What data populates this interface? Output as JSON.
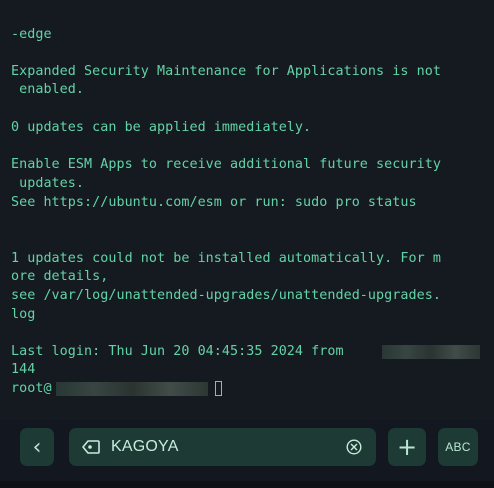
{
  "terminal": {
    "lines": [
      "-edge",
      "Expanded Security Maintenance for Applications is not",
      " enabled.",
      "0 updates can be applied immediately.",
      "Enable ESM Apps to receive additional future security",
      " updates.",
      "See https://ubuntu.com/esm or run: sudo pro status",
      "1 updates could not be installed automatically. For m",
      "ore details,",
      "see /var/log/unattended-upgrades/unattended-upgrades.",
      "log",
      "Last login: Thu Jun 20 04:45:35 2024 from",
      "144",
      "root@"
    ],
    "text_color": "#62d3a6"
  },
  "toolbar": {
    "back_icon": "chevron-left-icon",
    "back_glyph": "‹",
    "host_label": "KAGOYA",
    "host_icon": "tag-icon",
    "clear_icon": "circle-x-icon",
    "plus_glyph": "+",
    "abc_label": "ABC"
  }
}
